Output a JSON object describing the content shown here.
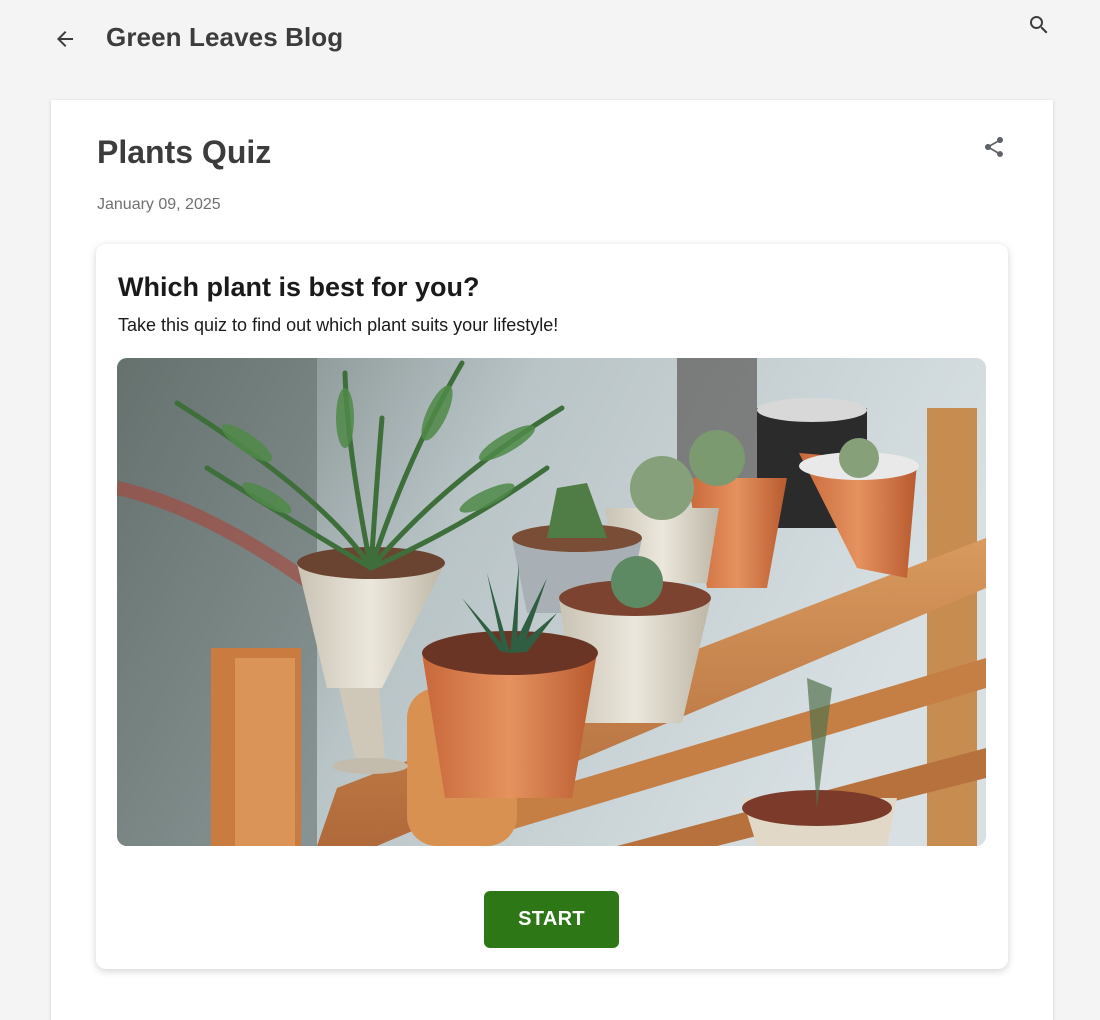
{
  "header": {
    "back_icon": "arrow-back-icon",
    "blog_title": "Green Leaves Blog",
    "search_icon": "search-icon"
  },
  "post": {
    "title": "Plants Quiz",
    "date": "January 09, 2025",
    "share_icon": "share-icon"
  },
  "quiz": {
    "heading": "Which plant is best for you?",
    "description": "Take this quiz to find out which plant suits your lifestyle!",
    "image_subject": "potted succulents and fern on wooden shelf",
    "start_label": "START",
    "start_color": "#2e7716"
  },
  "colors": {
    "page_bg": "#f4f4f4",
    "text_dark": "#3c3c3c",
    "text_muted": "#707070"
  }
}
